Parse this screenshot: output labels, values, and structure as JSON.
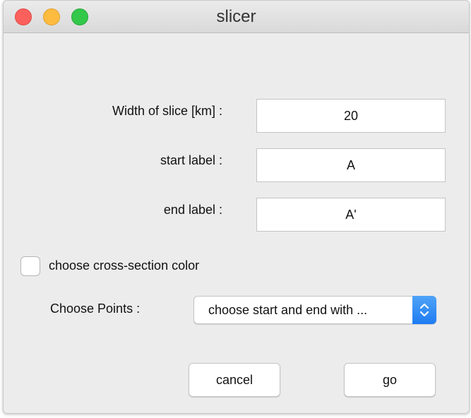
{
  "window": {
    "title": "slicer"
  },
  "form": {
    "width": {
      "label": "Width of slice [km] :",
      "value": "20"
    },
    "start": {
      "label": "start label :",
      "value": "A"
    },
    "end": {
      "label": "end label :",
      "value": "A'"
    }
  },
  "color_option": {
    "label": "choose cross-section color",
    "checked": false
  },
  "points": {
    "label": "Choose Points :",
    "selected": "choose start and end with ..."
  },
  "buttons": {
    "cancel": "cancel",
    "go": "go"
  },
  "colors": {
    "close": "#fc605c",
    "minimize": "#fdbc40",
    "zoom": "#34c84a",
    "accent": "#1e7cf2"
  }
}
